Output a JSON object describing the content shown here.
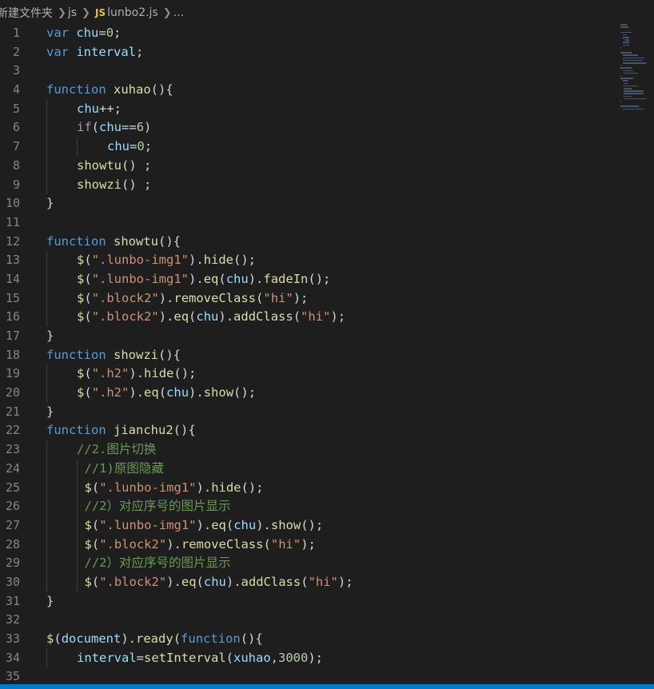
{
  "breadcrumb": {
    "folder": "新建文件夹",
    "subfolder": "js",
    "file_badge": "JS",
    "file": "lunbo2.js",
    "more": "..."
  },
  "editor": {
    "language": "javascript",
    "file": "lunbo2.js",
    "lines": [
      {
        "n": "1",
        "indent": 0,
        "tokens": [
          [
            "kw",
            "var"
          ],
          [
            "pn",
            " "
          ],
          [
            "vr",
            "chu"
          ],
          [
            "pn",
            "="
          ],
          [
            "nm",
            "0"
          ],
          [
            "pn",
            ";"
          ]
        ]
      },
      {
        "n": "2",
        "indent": 0,
        "tokens": [
          [
            "kw",
            "var"
          ],
          [
            "pn",
            " "
          ],
          [
            "vr",
            "interval"
          ],
          [
            "pn",
            ";"
          ]
        ]
      },
      {
        "n": "3",
        "indent": 0,
        "tokens": []
      },
      {
        "n": "4",
        "indent": 0,
        "tokens": [
          [
            "kw",
            "function"
          ],
          [
            "pn",
            " "
          ],
          [
            "fn",
            "xuhao"
          ],
          [
            "pn",
            "(){"
          ]
        ]
      },
      {
        "n": "5",
        "indent": 1,
        "tokens": [
          [
            "vr",
            "chu"
          ],
          [
            "pn",
            "++;"
          ]
        ]
      },
      {
        "n": "6",
        "indent": 1,
        "tokens": [
          [
            "ct",
            "if"
          ],
          [
            "pn",
            "("
          ],
          [
            "vr",
            "chu"
          ],
          [
            "pn",
            "=="
          ],
          [
            "nm",
            "6"
          ],
          [
            "pn",
            ")"
          ]
        ]
      },
      {
        "n": "7",
        "indent": 2,
        "tokens": [
          [
            "vr",
            "chu"
          ],
          [
            "pn",
            "="
          ],
          [
            "nm",
            "0"
          ],
          [
            "pn",
            ";"
          ]
        ]
      },
      {
        "n": "8",
        "indent": 1,
        "tokens": [
          [
            "fn",
            "showtu"
          ],
          [
            "pn",
            "() ;"
          ]
        ]
      },
      {
        "n": "9",
        "indent": 1,
        "tokens": [
          [
            "fn",
            "showzi"
          ],
          [
            "pn",
            "() ;"
          ]
        ]
      },
      {
        "n": "10",
        "indent": 0,
        "tokens": [
          [
            "pn",
            "}"
          ]
        ]
      },
      {
        "n": "11",
        "indent": 0,
        "tokens": []
      },
      {
        "n": "12",
        "indent": 0,
        "tokens": [
          [
            "kw",
            "function"
          ],
          [
            "pn",
            " "
          ],
          [
            "fn",
            "showtu"
          ],
          [
            "pn",
            "(){"
          ]
        ]
      },
      {
        "n": "13",
        "indent": 1,
        "tokens": [
          [
            "fn",
            "$"
          ],
          [
            "pn",
            "("
          ],
          [
            "st",
            "\".lunbo-img1\""
          ],
          [
            "pn",
            ")."
          ],
          [
            "fn",
            "hide"
          ],
          [
            "pn",
            "();"
          ]
        ]
      },
      {
        "n": "14",
        "indent": 1,
        "tokens": [
          [
            "fn",
            "$"
          ],
          [
            "pn",
            "("
          ],
          [
            "st",
            "\".lunbo-img1\""
          ],
          [
            "pn",
            ")."
          ],
          [
            "fn",
            "eq"
          ],
          [
            "pn",
            "("
          ],
          [
            "vr",
            "chu"
          ],
          [
            "pn",
            ")."
          ],
          [
            "fn",
            "fadeIn"
          ],
          [
            "pn",
            "();"
          ]
        ]
      },
      {
        "n": "15",
        "indent": 1,
        "tokens": [
          [
            "fn",
            "$"
          ],
          [
            "pn",
            "("
          ],
          [
            "st",
            "\".block2\""
          ],
          [
            "pn",
            ")."
          ],
          [
            "fn",
            "removeClass"
          ],
          [
            "pn",
            "("
          ],
          [
            "st",
            "\"hi\""
          ],
          [
            "pn",
            ");"
          ]
        ]
      },
      {
        "n": "16",
        "indent": 1,
        "tokens": [
          [
            "fn",
            "$"
          ],
          [
            "pn",
            "("
          ],
          [
            "st",
            "\".block2\""
          ],
          [
            "pn",
            ")."
          ],
          [
            "fn",
            "eq"
          ],
          [
            "pn",
            "("
          ],
          [
            "vr",
            "chu"
          ],
          [
            "pn",
            ")."
          ],
          [
            "fn",
            "addClass"
          ],
          [
            "pn",
            "("
          ],
          [
            "st",
            "\"hi\""
          ],
          [
            "pn",
            ");"
          ]
        ]
      },
      {
        "n": "17",
        "indent": 0,
        "tokens": [
          [
            "pn",
            "}"
          ]
        ]
      },
      {
        "n": "18",
        "indent": 0,
        "tokens": [
          [
            "kw",
            "function"
          ],
          [
            "pn",
            " "
          ],
          [
            "fn",
            "showzi"
          ],
          [
            "pn",
            "(){"
          ]
        ]
      },
      {
        "n": "19",
        "indent": 1,
        "tokens": [
          [
            "fn",
            "$"
          ],
          [
            "pn",
            "("
          ],
          [
            "st",
            "\".h2\""
          ],
          [
            "pn",
            ")."
          ],
          [
            "fn",
            "hide"
          ],
          [
            "pn",
            "();"
          ]
        ]
      },
      {
        "n": "20",
        "indent": 1,
        "tokens": [
          [
            "fn",
            "$"
          ],
          [
            "pn",
            "("
          ],
          [
            "st",
            "\".h2\""
          ],
          [
            "pn",
            ")."
          ],
          [
            "fn",
            "eq"
          ],
          [
            "pn",
            "("
          ],
          [
            "vr",
            "chu"
          ],
          [
            "pn",
            ")."
          ],
          [
            "fn",
            "show"
          ],
          [
            "pn",
            "();"
          ]
        ]
      },
      {
        "n": "21",
        "indent": 0,
        "tokens": [
          [
            "pn",
            "}"
          ]
        ]
      },
      {
        "n": "22",
        "indent": 0,
        "tokens": [
          [
            "kw",
            "function"
          ],
          [
            "pn",
            " "
          ],
          [
            "fn",
            "jianchu2"
          ],
          [
            "pn",
            "(){"
          ]
        ]
      },
      {
        "n": "23",
        "indent": 1,
        "tokens": [
          [
            "cm",
            "//2.图片切换"
          ]
        ]
      },
      {
        "n": "24",
        "indent": 1.25,
        "tokens": [
          [
            "cm",
            "//1)原图隐藏"
          ]
        ]
      },
      {
        "n": "25",
        "indent": 1.25,
        "tokens": [
          [
            "fn",
            "$"
          ],
          [
            "pn",
            "("
          ],
          [
            "st",
            "\".lunbo-img1\""
          ],
          [
            "pn",
            ")."
          ],
          [
            "fn",
            "hide"
          ],
          [
            "pn",
            "();"
          ]
        ]
      },
      {
        "n": "26",
        "indent": 1.25,
        "tokens": [
          [
            "cm",
            "//2）对应序号的图片显示"
          ]
        ]
      },
      {
        "n": "27",
        "indent": 1.25,
        "tokens": [
          [
            "fn",
            "$"
          ],
          [
            "pn",
            "("
          ],
          [
            "st",
            "\".lunbo-img1\""
          ],
          [
            "pn",
            ")."
          ],
          [
            "fn",
            "eq"
          ],
          [
            "pn",
            "("
          ],
          [
            "vr",
            "chu"
          ],
          [
            "pn",
            ")."
          ],
          [
            "fn",
            "show"
          ],
          [
            "pn",
            "();"
          ]
        ]
      },
      {
        "n": "28",
        "indent": 1.25,
        "tokens": [
          [
            "fn",
            "$"
          ],
          [
            "pn",
            "("
          ],
          [
            "st",
            "\".block2\""
          ],
          [
            "pn",
            ")."
          ],
          [
            "fn",
            "removeClass"
          ],
          [
            "pn",
            "("
          ],
          [
            "st",
            "\"hi\""
          ],
          [
            "pn",
            ");"
          ]
        ]
      },
      {
        "n": "29",
        "indent": 1.25,
        "tokens": [
          [
            "cm",
            "//2）对应序号的图片显示"
          ]
        ]
      },
      {
        "n": "30",
        "indent": 1.25,
        "tokens": [
          [
            "fn",
            "$"
          ],
          [
            "pn",
            "("
          ],
          [
            "st",
            "\".block2\""
          ],
          [
            "pn",
            ")."
          ],
          [
            "fn",
            "eq"
          ],
          [
            "pn",
            "("
          ],
          [
            "vr",
            "chu"
          ],
          [
            "pn",
            ")."
          ],
          [
            "fn",
            "addClass"
          ],
          [
            "pn",
            "("
          ],
          [
            "st",
            "\"hi\""
          ],
          [
            "pn",
            ");"
          ]
        ]
      },
      {
        "n": "31",
        "indent": 0,
        "tokens": [
          [
            "pn",
            "}"
          ]
        ]
      },
      {
        "n": "32",
        "indent": 0,
        "tokens": []
      },
      {
        "n": "33",
        "indent": 0,
        "tokens": [
          [
            "fn",
            "$"
          ],
          [
            "pn",
            "("
          ],
          [
            "vr",
            "document"
          ],
          [
            "pn",
            ")."
          ],
          [
            "fn",
            "ready"
          ],
          [
            "pn",
            "("
          ],
          [
            "kw",
            "function"
          ],
          [
            "pn",
            "(){"
          ]
        ]
      },
      {
        "n": "34",
        "indent": 1,
        "tokens": [
          [
            "vr",
            "interval"
          ],
          [
            "pn",
            "="
          ],
          [
            "fn",
            "setInterval"
          ],
          [
            "pn",
            "("
          ],
          [
            "vr",
            "xuhao"
          ],
          [
            "pn",
            ","
          ],
          [
            "nm",
            "3000"
          ],
          [
            "pn",
            ");"
          ]
        ]
      },
      {
        "n": "35",
        "indent": 0,
        "tokens": []
      }
    ]
  }
}
